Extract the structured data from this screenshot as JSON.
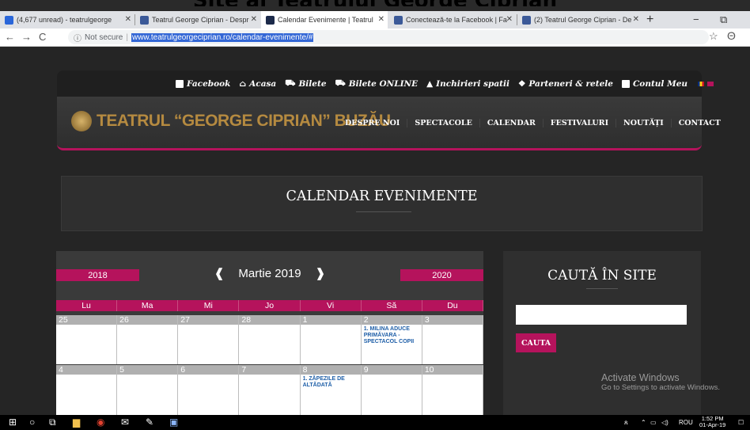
{
  "caption": "Site al Teatrului George Ciprian",
  "tabs": [
    {
      "label": "(4,677 unread) - teatrulgeorge",
      "color": "#2a66d9"
    },
    {
      "label": "Teatrul George Ciprian - Despr",
      "color": "#3b5998"
    },
    {
      "label": "Calendar Evenimente | Teatrul",
      "color": "#1c2a4a"
    },
    {
      "label": "Conectează-te la Facebook | Fa",
      "color": "#3b5998"
    },
    {
      "label": "(2) Teatrul George Ciprian - De",
      "color": "#3b5998"
    }
  ],
  "window_controls": {
    "minimize": "−",
    "restore": "⧉"
  },
  "address": {
    "info": "ⓘ",
    "not_secure": "Not secure",
    "url": "www.teatrulgeorgeciprian.ro/calendar-evenimente/#"
  },
  "topnav": {
    "links": [
      "Facebook",
      "Acasa",
      "Bilete",
      "Bilete ONLINE",
      "Inchirieri spatii",
      "Parteneri & retele",
      "Contul Meu"
    ]
  },
  "header": {
    "logo_text": "TEATRUL “GEORGE CIPRIAN” BUZĂU",
    "menu": [
      "DESPRE NOI",
      "SPECTACOLE",
      "CALENDAR",
      "FESTIVALURI",
      "NOUTĂȚI",
      "CONTACT"
    ]
  },
  "title": "CALENDAR EVENIMENTE",
  "calendar": {
    "prev_year": "2018",
    "next_year": "2020",
    "prev_arrow": "❰",
    "next_arrow": "❱",
    "month_label": "Martie 2019",
    "days": [
      "Lu",
      "Ma",
      "Mi",
      "Jo",
      "Vi",
      "Să",
      "Du"
    ],
    "weeks": [
      {
        "nums": [
          "25",
          "26",
          "27",
          "28",
          "1",
          "2",
          "3"
        ],
        "events": [
          "",
          "",
          "",
          "",
          "",
          "1. MILINA ADUCE PRIMĂVARA - SPECTACOL COPII",
          ""
        ]
      },
      {
        "nums": [
          "4",
          "5",
          "6",
          "7",
          "8",
          "9",
          "10"
        ],
        "events": [
          "",
          "",
          "",
          "",
          "1. ZĂPEZILE DE ALTĂDATĂ",
          "",
          ""
        ]
      }
    ]
  },
  "sidebar": {
    "title": "CAUTĂ ÎN SITE",
    "button": "CAUTA"
  },
  "activate": {
    "line1": "Activate Windows",
    "line2": "Go to Settings to activate Windows."
  },
  "taskbar": {
    "lang": "ROU",
    "time": "1:52 PM",
    "date": "01-Apr-19"
  }
}
